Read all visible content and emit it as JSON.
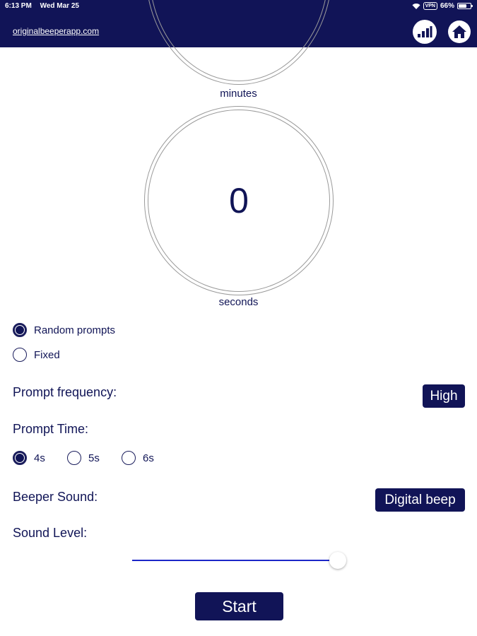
{
  "status_bar": {
    "time": "6:13 PM",
    "date": "Wed Mar 25",
    "vpn": "VPN",
    "battery_text": "66%",
    "battery_level": 0.66
  },
  "header": {
    "site_link": "originalbeeperapp.com",
    "icons": [
      "stats-chart-icon",
      "home-icon"
    ]
  },
  "timer": {
    "minutes_label": "minutes",
    "seconds_value": "0",
    "seconds_label": "seconds"
  },
  "prompt_mode": {
    "options": [
      {
        "label": "Random prompts",
        "selected": true
      },
      {
        "label": "Fixed",
        "selected": false
      }
    ]
  },
  "settings": {
    "frequency_label": "Prompt frequency:",
    "frequency_value": "High",
    "prompt_time_label": "Prompt Time:",
    "prompt_time_options": [
      {
        "label": "4s",
        "selected": true
      },
      {
        "label": "5s",
        "selected": false
      },
      {
        "label": "6s",
        "selected": false
      }
    ],
    "beeper_label": "Beeper Sound:",
    "beeper_value": "Digital beep",
    "sound_level_label": "Sound Level:",
    "sound_level": 1.0
  },
  "actions": {
    "start_label": "Start"
  },
  "colors": {
    "primary": "#111457",
    "slider": "#1c26c8"
  }
}
